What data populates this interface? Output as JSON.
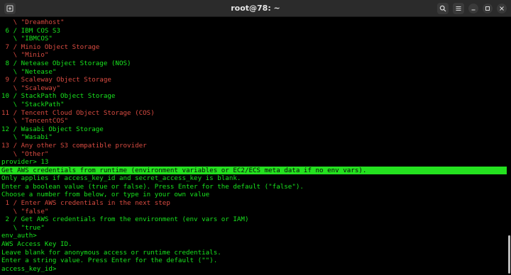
{
  "window": {
    "title": "root@78: ~",
    "icons": {
      "new_tab": "new-tab-icon",
      "search": "search-icon",
      "menu": "hamburger-menu-icon",
      "minimize": "minimize-icon",
      "maximize": "maximize-icon",
      "close": "close-icon"
    },
    "colors": {
      "terminal_bg": "#000000",
      "titlebar_bg": "#2b2b2b",
      "text_green": "#18e31e",
      "text_red": "#d84b41",
      "highlight": "#24e11f"
    }
  },
  "terminal": {
    "lines": [
      {
        "text": "   \\ \"Dreamhost\"",
        "style": "red"
      },
      {
        "text": " 6 / IBM COS S3",
        "style": "green"
      },
      {
        "text": "   \\ \"IBMCOS\"",
        "style": "green"
      },
      {
        "text": " 7 / Minio Object Storage",
        "style": "red"
      },
      {
        "text": "   \\ \"Minio\"",
        "style": "red"
      },
      {
        "text": " 8 / Netease Object Storage (NOS)",
        "style": "green"
      },
      {
        "text": "   \\ \"Netease\"",
        "style": "green"
      },
      {
        "text": " 9 / Scaleway Object Storage",
        "style": "red"
      },
      {
        "text": "   \\ \"Scaleway\"",
        "style": "red"
      },
      {
        "text": "10 / StackPath Object Storage",
        "style": "green"
      },
      {
        "text": "   \\ \"StackPath\"",
        "style": "green"
      },
      {
        "text": "11 / Tencent Cloud Object Storage (COS)",
        "style": "red"
      },
      {
        "text": "   \\ \"TencentCOS\"",
        "style": "red"
      },
      {
        "text": "12 / Wasabi Object Storage",
        "style": "green"
      },
      {
        "text": "   \\ \"Wasabi\"",
        "style": "green"
      },
      {
        "text": "13 / Any other S3 compatible provider",
        "style": "red"
      },
      {
        "text": "   \\ \"Other\"",
        "style": "red"
      },
      {
        "text": "provider> 13",
        "style": "green"
      },
      {
        "text": "Get AWS credentials from runtime (environment variables or EC2/ECS meta data if no env vars).",
        "style": "hl"
      },
      {
        "text": "Only applies if access_key_id and secret_access_key is blank.",
        "style": "green"
      },
      {
        "text": "Enter a boolean value (true or false). Press Enter for the default (\"false\").",
        "style": "green"
      },
      {
        "text": "Choose a number from below, or type in your own value",
        "style": "green"
      },
      {
        "text": " 1 / Enter AWS credentials in the next step",
        "style": "red"
      },
      {
        "text": "   \\ \"false\"",
        "style": "red"
      },
      {
        "text": " 2 / Get AWS credentials from the environment (env vars or IAM)",
        "style": "green"
      },
      {
        "text": "   \\ \"true\"",
        "style": "green"
      },
      {
        "text": "env_auth>",
        "style": "green"
      },
      {
        "text": "AWS Access Key ID.",
        "style": "green"
      },
      {
        "text": "Leave blank for anonymous access or runtime credentials.",
        "style": "green"
      },
      {
        "text": "Enter a string value. Press Enter for the default (\"\").",
        "style": "green"
      },
      {
        "text": "access_key_id>",
        "style": "green"
      }
    ]
  }
}
